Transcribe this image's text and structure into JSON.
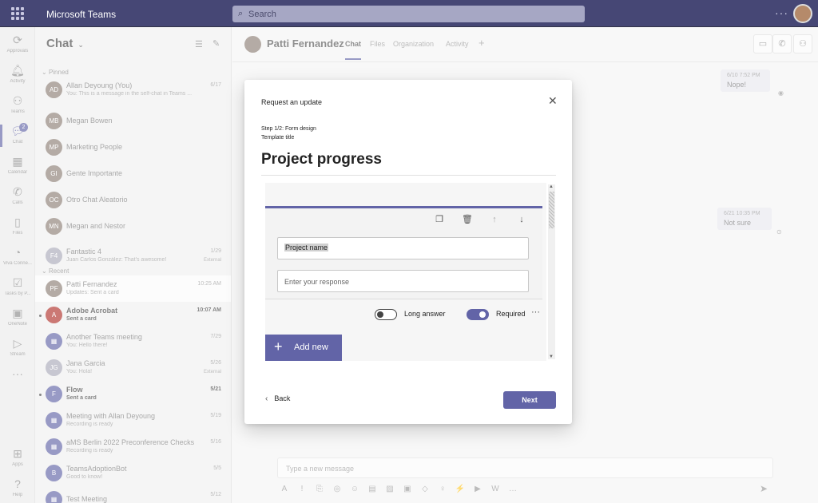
{
  "app": {
    "title": "Microsoft Teams",
    "search_placeholder": "Search",
    "more": "···"
  },
  "rail": {
    "items": [
      {
        "label": "Approvals",
        "icon": "approvals-icon",
        "glyph": "⟳"
      },
      {
        "label": "Activity",
        "icon": "bell-icon",
        "glyph": "🔔︎"
      },
      {
        "label": "Teams",
        "icon": "teams-icon",
        "glyph": "⚇"
      },
      {
        "label": "Chat",
        "icon": "chat-icon",
        "glyph": "💬︎",
        "badge": "2"
      },
      {
        "label": "Calendar",
        "icon": "calendar-icon",
        "glyph": "▦"
      },
      {
        "label": "Calls",
        "icon": "phone-icon",
        "glyph": "✆"
      },
      {
        "label": "Files",
        "icon": "file-icon",
        "glyph": "▯"
      },
      {
        "label": "Viva Conne...",
        "icon": "viva-icon",
        "glyph": "◔"
      },
      {
        "label": "Tasks by P...",
        "icon": "tasks-icon",
        "glyph": "☑"
      },
      {
        "label": "OneNote",
        "icon": "onenote-icon",
        "glyph": "▣"
      },
      {
        "label": "Stream",
        "icon": "stream-icon",
        "glyph": "▷"
      },
      {
        "label": "",
        "icon": "more-apps-icon",
        "glyph": "···"
      },
      {
        "label": "Apps",
        "icon": "apps-icon",
        "glyph": "⊞"
      },
      {
        "label": "Help",
        "icon": "help-icon",
        "glyph": "?"
      }
    ]
  },
  "chatlist": {
    "header": "Chat",
    "pinned_label": "Pinned",
    "recent_label": "Recent",
    "pinned": [
      {
        "name": "Allan Deyoung (You)",
        "preview": "You: This is a message in the self-chat in Teams ...",
        "time": "6/17",
        "av": "AD",
        "style": "photo"
      },
      {
        "name": "Megan Bowen",
        "preview": "",
        "time": "",
        "av": "MB",
        "style": "photo"
      },
      {
        "name": "Marketing People",
        "preview": "",
        "time": "",
        "av": "MP",
        "style": "photo"
      },
      {
        "name": "Gente Importante",
        "preview": "",
        "time": "",
        "av": "GI",
        "style": "photo"
      },
      {
        "name": "Otro Chat Aleatorio",
        "preview": "",
        "time": "",
        "av": "OC",
        "style": "photo"
      },
      {
        "name": "Megan and Nestor",
        "preview": "",
        "time": "",
        "av": "MN",
        "style": "photo"
      },
      {
        "name": "Fantastic 4",
        "preview": "Juan Carlos González: That's awesome!",
        "time": "1/29",
        "tag": "External",
        "av": "F4",
        "style": ""
      }
    ],
    "recent": [
      {
        "name": "Patti Fernandez",
        "preview": "Updates: Sent a card",
        "time": "10:25 AM",
        "av": "PF",
        "style": "photo",
        "selected": true
      },
      {
        "name": "Adobe Acrobat",
        "preview": "Sent a card",
        "time": "10:07 AM",
        "av": "A",
        "style": "red",
        "bold": true
      },
      {
        "name": "Another Teams meeting",
        "preview": "You: Hello there!",
        "time": "7/29",
        "av": "▦",
        "style": "purple"
      },
      {
        "name": "Jana Garcia",
        "preview": "You: Hola!",
        "time": "5/26",
        "tag": "External",
        "av": "JG",
        "style": ""
      },
      {
        "name": "Flow",
        "preview": "Sent a card",
        "time": "5/21",
        "av": "F",
        "style": "purple",
        "bold": true
      },
      {
        "name": "Meeting with Allan Deyoung",
        "preview": "Recording is ready",
        "time": "5/19",
        "av": "▦",
        "style": "purple"
      },
      {
        "name": "aMS Berlin 2022 Preconference Checks",
        "preview": "Recording is ready",
        "time": "5/16",
        "av": "▦",
        "style": "purple"
      },
      {
        "name": "TeamsAdoptionBot",
        "preview": "Good to know!",
        "time": "5/5",
        "av": "B",
        "style": "purple"
      },
      {
        "name": "Test Meeting",
        "preview": "",
        "time": "5/12",
        "av": "▦",
        "style": "purple"
      }
    ]
  },
  "main": {
    "person": "Patti Fernandez",
    "tabs": [
      "Chat",
      "Files",
      "Organization",
      "Activity"
    ],
    "add_tab": "+",
    "messages": [
      {
        "time": "6/10 7:52 PM",
        "text": "Nope!"
      },
      {
        "time": "6/21 10:35 PM",
        "text": "Not sure"
      }
    ],
    "compose_placeholder": "Type a new message"
  },
  "dialog": {
    "title": "Request an update",
    "close": "✕",
    "step": "Step 1/2: Form design",
    "template_label": "Template title",
    "template_title": "Project progress",
    "question_title": "Project name",
    "response_placeholder": "Enter your response",
    "long_answer_label": "Long answer",
    "long_answer_on": false,
    "required_label": "Required",
    "required_on": true,
    "more": "···",
    "add_new": "Add new",
    "back": "Back",
    "next": "Next"
  },
  "colors": {
    "brand": "#6264a7",
    "titlebar": "#464775"
  }
}
